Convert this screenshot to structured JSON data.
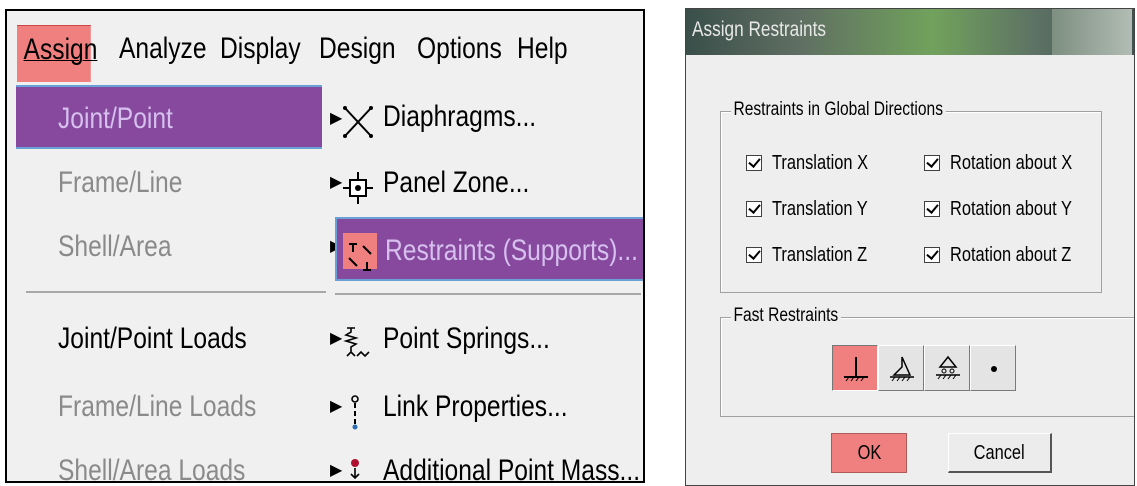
{
  "menubar": {
    "items": [
      {
        "label": "Assign",
        "state": "active"
      },
      {
        "label": "Analyze"
      },
      {
        "label": "Display"
      },
      {
        "label": "Design"
      },
      {
        "label": "Options"
      },
      {
        "label": "Help"
      }
    ]
  },
  "assign_menu": {
    "items": [
      {
        "label": "Joint/Point",
        "state": "selected",
        "has_submenu": true
      },
      {
        "label": "Frame/Line",
        "state": "disabled",
        "has_submenu": true
      },
      {
        "label": "Shell/Area",
        "state": "disabled",
        "has_submenu": true
      },
      {
        "label": "Joint/Point Loads",
        "state": "enabled",
        "has_submenu": true
      },
      {
        "label": "Frame/Line Loads",
        "state": "disabled",
        "has_submenu": true
      },
      {
        "label": "Shell/Area Loads",
        "state": "disabled",
        "has_submenu": true
      }
    ]
  },
  "joint_submenu": {
    "items": [
      {
        "label": "Diaphragms...",
        "icon": "diaphragm-icon"
      },
      {
        "label": "Panel Zone...",
        "icon": "panel-zone-icon"
      },
      {
        "label": "Restraints (Supports)...",
        "icon": "restraints-icon",
        "state": "selected"
      },
      {
        "label": "Point Springs...",
        "icon": "spring-icon"
      },
      {
        "label": "Link Properties...",
        "icon": "link-icon"
      },
      {
        "label": "Additional Point Mass...",
        "icon": "point-mass-icon"
      }
    ]
  },
  "dialog": {
    "title": "Assign Restraints",
    "global_group": {
      "title": "Restraints in Global Directions",
      "checkboxes": [
        {
          "label": "Translation X",
          "checked": true
        },
        {
          "label": "Rotation about X",
          "checked": true
        },
        {
          "label": "Translation Y",
          "checked": true
        },
        {
          "label": "Rotation about Y",
          "checked": true
        },
        {
          "label": "Translation Z",
          "checked": true
        },
        {
          "label": "Rotation about Z",
          "checked": true
        }
      ]
    },
    "fast_group": {
      "title": "Fast Restraints",
      "buttons": [
        {
          "icon": "fixed-support-icon",
          "state": "active"
        },
        {
          "icon": "pinned-support-icon"
        },
        {
          "icon": "roller-support-icon"
        },
        {
          "icon": "free-dot-icon"
        }
      ]
    },
    "ok_label": "OK",
    "cancel_label": "Cancel"
  },
  "colors": {
    "highlight_purple": "#86499e",
    "highlight_pink": "#f08080",
    "disabled_text": "#8a8a8a"
  }
}
